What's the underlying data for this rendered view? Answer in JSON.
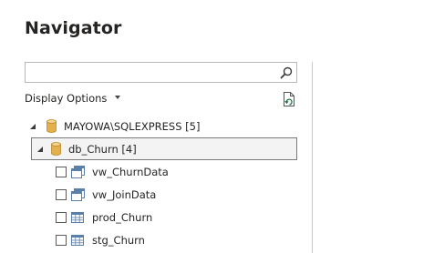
{
  "title": "Navigator",
  "search": {
    "value": "",
    "placeholder": ""
  },
  "display_options": {
    "label": "Display Options"
  },
  "tree": {
    "server": {
      "label": "MAYOWA\\SQLEXPRESS [5]"
    },
    "database": {
      "label": "db_Churn [4]"
    },
    "items": [
      {
        "label": "vw_ChurnData",
        "icon": "view-icon",
        "checked": false
      },
      {
        "label": "vw_JoinData",
        "icon": "view-icon",
        "checked": false
      },
      {
        "label": "prod_Churn",
        "icon": "table-icon",
        "checked": false
      },
      {
        "label": "stg_Churn",
        "icon": "table-icon",
        "checked": false
      }
    ]
  },
  "colors": {
    "accent": "#217346",
    "database_icon": "#e3b04b",
    "selected_row_bg": "#f3f3f3"
  }
}
